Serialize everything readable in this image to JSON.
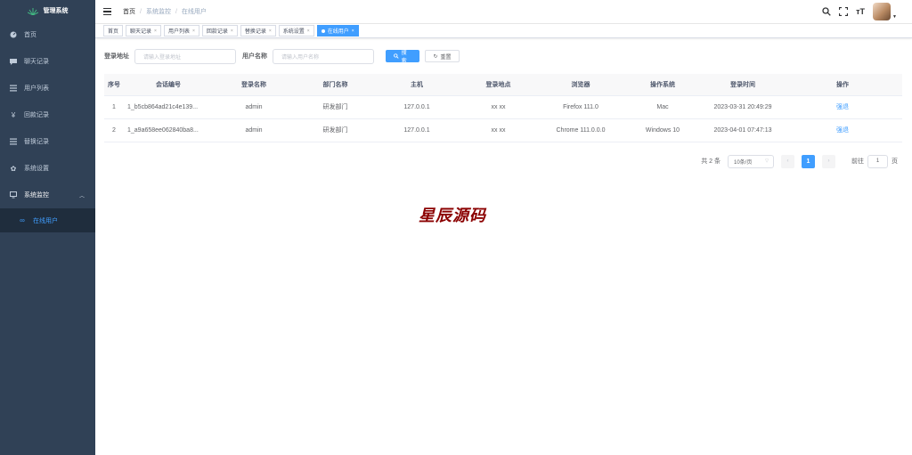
{
  "app": {
    "title": "管理系统"
  },
  "sidebar": {
    "items": [
      {
        "label": "首页",
        "icon": "dashboard-icon"
      },
      {
        "label": "聊天记录",
        "icon": "chat-icon"
      },
      {
        "label": "用户列表",
        "icon": "list-icon"
      },
      {
        "label": "回款记录",
        "icon": "yen-icon"
      },
      {
        "label": "替换记录",
        "icon": "list-icon"
      },
      {
        "label": "系统设置",
        "icon": "gear-icon"
      },
      {
        "label": "系统监控",
        "icon": "monitor-icon"
      }
    ],
    "subitem": {
      "label": "在线用户",
      "icon": "online-icon"
    }
  },
  "breadcrumb": {
    "home": "首页",
    "parent": "系统监控",
    "current": "在线用户"
  },
  "tags": [
    {
      "label": "首页"
    },
    {
      "label": "聊天记录"
    },
    {
      "label": "用户列表"
    },
    {
      "label": "回款记录"
    },
    {
      "label": "替换记录"
    },
    {
      "label": "系统设置"
    },
    {
      "label": "在线用户"
    }
  ],
  "search": {
    "addr_label": "登录地址",
    "addr_placeholder": "请输入登录地址",
    "user_label": "用户名称",
    "user_placeholder": "请输入用户名称",
    "search_btn": "搜索",
    "reset_btn": "重置"
  },
  "table": {
    "headers": [
      "序号",
      "会话编号",
      "登录名称",
      "部门名称",
      "主机",
      "登录地点",
      "浏览器",
      "操作系统",
      "登录时间",
      "操作"
    ],
    "rows": [
      [
        "1",
        "1_b5cb864ad21c4e139...",
        "admin",
        "研发部门",
        "127.0.0.1",
        "xx xx",
        "Firefox 111.0",
        "Mac",
        "2023-03-31 20:49:29",
        "强退"
      ],
      [
        "2",
        "1_a9a658ee062840ba8...",
        "admin",
        "研发部门",
        "127.0.0.1",
        "xx xx",
        "Chrome 111.0.0.0",
        "Windows 10",
        "2023-04-01 07:47:13",
        "强退"
      ]
    ]
  },
  "pagination": {
    "total": "共 2 条",
    "page_size": "10条/页",
    "current": "1",
    "goto_prefix": "前往",
    "goto_value": "1",
    "goto_suffix": "页"
  },
  "watermark": "星辰源码",
  "colors": {
    "sidebar_bg": "#304156",
    "accent": "#409eff",
    "watermark": "#8b0000"
  }
}
